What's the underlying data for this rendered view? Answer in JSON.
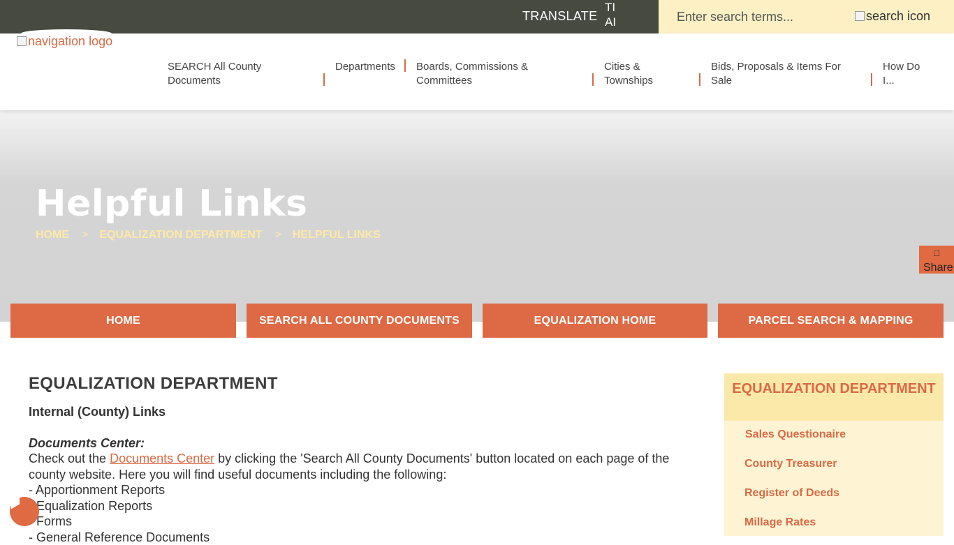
{
  "topbar": {
    "translate_label": "TRANSLATE",
    "translate_img_alt": "TI AI",
    "search_placeholder": "Enter search terms...",
    "search_icon_alt": "search icon"
  },
  "nav": {
    "logo_alt": "navigation logo",
    "items": [
      {
        "label": "SEARCH All County Documents"
      },
      {
        "label": "Departments"
      },
      {
        "label": "Boards, Commissions & Committees"
      },
      {
        "label": "Cities & Townships"
      },
      {
        "label": "Bids, Proposals & Items For Sale"
      },
      {
        "label": "How Do I..."
      }
    ]
  },
  "hero": {
    "title": "Helpful Links",
    "breadcrumb": [
      "HOME",
      "EQUALIZATION DEPARTMENT",
      "HELPFUL LINKS"
    ],
    "breadcrumb_sep": ">"
  },
  "share": {
    "label": "Share"
  },
  "quick_links": [
    "HOME",
    "SEARCH ALL COUNTY DOCUMENTS",
    "EQUALIZATION HOME",
    "PARCEL SEARCH & MAPPING"
  ],
  "main": {
    "heading": "EQUALIZATION DEPARTMENT",
    "subheading": "Internal (County) Links",
    "doc_label": "Documents Center:",
    "para_pre": "Check out the ",
    "para_link": "Documents Center",
    "para_post": " by clicking the 'Search All County Documents' button located on each page of the county website. Here you will find useful documents including the following:",
    "list": [
      "- Apportionment Reports",
      "- Equalization Reports",
      "- Forms",
      "- General Reference Documents"
    ]
  },
  "sidebar": {
    "heading": "EQUALIZATION DEPARTMENT",
    "links": [
      "Sales Questionaire",
      "County Treasurer",
      "Register of Deeds",
      "Millage Rates"
    ]
  },
  "colors": {
    "topbar": "#474a41",
    "search_bg": "#fcf0c4",
    "accent": "#dd6a44",
    "breadcrumb": "#fde9a6",
    "sidebar_head": "#fbe9a9",
    "sidebar_bg": "#fef4d4"
  }
}
